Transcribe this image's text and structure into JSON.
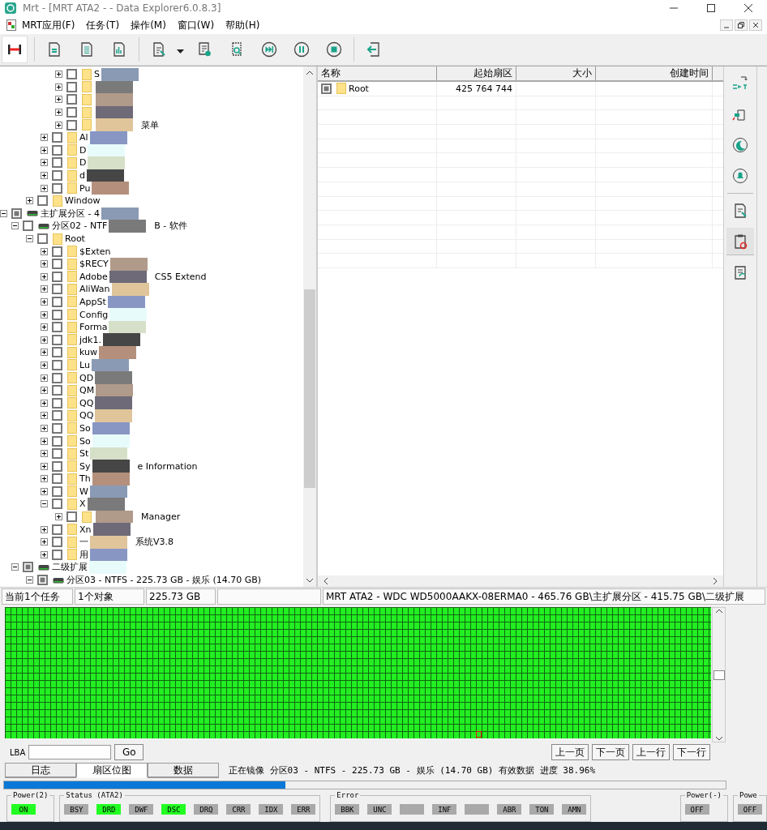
{
  "window": {
    "title": "Mrt - [MRT ATA2 -  - Data Explorer6.0.8.3]"
  },
  "menu": [
    "MRT应用(F)",
    "任务(T)",
    "操作(M)",
    "窗口(W)",
    "帮助(H)"
  ],
  "toolbar": [
    {
      "pressed": true
    },
    {
      "pressed": false
    },
    {
      "pressed": false
    },
    {
      "pressed": false
    },
    {
      "pressed": false
    },
    {
      "pressed": false
    },
    {
      "pressed": false
    },
    {
      "pressed": false
    },
    {
      "pressed": false
    },
    {
      "pressed": false
    },
    {
      "pressed": false
    }
  ],
  "tree": [
    {
      "children": [
        {
          "children": [
            {
              "children": [
                {
                  "children": [
                    {
                      "kind": "folder",
                      "label": "S",
                      "checked": false,
                      "expanded": false,
                      "masked": true
                    },
                    {
                      "kind": "folder",
                      "checked": false,
                      "expanded": false,
                      "masked": true
                    },
                    {
                      "kind": "folder",
                      "checked": false,
                      "expanded": false,
                      "masked": true
                    },
                    {
                      "kind": "folder",
                      "checked": false,
                      "expanded": false,
                      "masked": true
                    },
                    {
                      "kind": "folder",
                      "checked": false,
                      "expanded": false,
                      "masked": true,
                      "suffix": "菜单"
                    }
                  ]
                },
                {
                  "kind": "folder",
                  "label": "Al",
                  "checked": false,
                  "expanded": false,
                  "masked": true
                },
                {
                  "kind": "folder",
                  "label": "D",
                  "checked": false,
                  "expanded": false,
                  "masked": true
                },
                {
                  "kind": "folder",
                  "label": "D",
                  "checked": false,
                  "expanded": false,
                  "masked": true
                },
                {
                  "kind": "folder",
                  "label": "d",
                  "checked": false,
                  "expanded": false,
                  "masked": true
                },
                {
                  "kind": "folder",
                  "label": "Pu",
                  "checked": false,
                  "expanded": false,
                  "masked": true
                }
              ]
            },
            {
              "kind": "folder",
              "label": "Window",
              "checked": false,
              "expanded": false,
              "masked": false
            }
          ]
        }
      ]
    },
    {
      "kind": "drive",
      "label": "主扩展分区 - 4",
      "checked": true,
      "expanded": true,
      "masked": true,
      "children": [
        {
          "kind": "drive",
          "label": "分区02 - NTF",
          "checked": false,
          "expanded": true,
          "masked": true,
          "suffix": "B - 软件",
          "children": [
            {
              "kind": "folder",
              "label": "Root",
              "checked": false,
              "expanded": true,
              "masked": false,
              "children": [
                {
                  "kind": "folder",
                  "label": "$Exten",
                  "checked": false,
                  "expanded": false,
                  "masked": false
                },
                {
                  "kind": "folder",
                  "label": "$RECY",
                  "checked": false,
                  "expanded": false,
                  "masked": true
                },
                {
                  "kind": "folder",
                  "label": "Adobe",
                  "checked": false,
                  "expanded": false,
                  "masked": true,
                  "suffix": "CS5 Extend"
                },
                {
                  "kind": "folder",
                  "label": "AliWan",
                  "checked": false,
                  "expanded": false,
                  "masked": true
                },
                {
                  "kind": "folder",
                  "label": "AppSt",
                  "checked": false,
                  "expanded": false,
                  "masked": true
                },
                {
                  "kind": "folder",
                  "label": "Config",
                  "checked": false,
                  "expanded": false,
                  "masked": true
                },
                {
                  "kind": "folder",
                  "label": "Forma",
                  "checked": false,
                  "expanded": false,
                  "masked": true
                },
                {
                  "kind": "folder",
                  "label": "jdk1.",
                  "checked": false,
                  "expanded": false,
                  "masked": true
                },
                {
                  "kind": "folder",
                  "label": "kuw",
                  "checked": false,
                  "expanded": false,
                  "masked": true
                },
                {
                  "kind": "folder",
                  "label": "Lu",
                  "checked": false,
                  "expanded": false,
                  "masked": true
                },
                {
                  "kind": "folder",
                  "label": "QD",
                  "checked": false,
                  "expanded": false,
                  "masked": true
                },
                {
                  "kind": "folder",
                  "label": "QM",
                  "checked": false,
                  "expanded": false,
                  "masked": true
                },
                {
                  "kind": "folder",
                  "label": "QQ",
                  "checked": false,
                  "expanded": false,
                  "masked": true
                },
                {
                  "kind": "folder",
                  "label": "QQ",
                  "checked": false,
                  "expanded": false,
                  "masked": true
                },
                {
                  "kind": "folder",
                  "label": "So",
                  "checked": false,
                  "expanded": false,
                  "masked": true
                },
                {
                  "kind": "folder",
                  "label": "So",
                  "checked": false,
                  "expanded": false,
                  "masked": true
                },
                {
                  "kind": "folder",
                  "label": "St",
                  "checked": false,
                  "expanded": false,
                  "masked": true
                },
                {
                  "kind": "folder",
                  "label": "Sy",
                  "checked": false,
                  "expanded": false,
                  "masked": true,
                  "suffix": "e Information"
                },
                {
                  "kind": "folder",
                  "label": "Th",
                  "checked": false,
                  "expanded": false,
                  "masked": true
                },
                {
                  "kind": "folder",
                  "label": "W",
                  "checked": false,
                  "expanded": false,
                  "masked": true
                },
                {
                  "kind": "folder",
                  "label": "X",
                  "checked": false,
                  "expanded": true,
                  "masked": true,
                  "children": [
                    {
                      "kind": "folder",
                      "checked": false,
                      "expanded": false,
                      "masked": true,
                      "suffix": "Manager"
                    }
                  ]
                },
                {
                  "kind": "folder",
                  "label": "Xn",
                  "checked": false,
                  "expanded": false,
                  "masked": true
                },
                {
                  "kind": "folder",
                  "label": "一",
                  "checked": false,
                  "expanded": false,
                  "masked": true,
                  "suffix": "系统V3.8"
                },
                {
                  "kind": "folder",
                  "label": "用",
                  "checked": false,
                  "expanded": false,
                  "masked": true
                }
              ]
            }
          ]
        },
        {
          "kind": "drive",
          "label": "二级扩展",
          "checked": true,
          "expanded": true,
          "masked": true,
          "children": [
            {
              "kind": "drive",
              "label": "分区03 - NTFS - 225.73 GB - 娱乐 (14.70 GB)",
              "checked": true,
              "expanded": true,
              "masked": false
            }
          ]
        }
      ]
    }
  ],
  "list": {
    "columns": [
      "名称",
      "起始扇区",
      "大小",
      "创建时间"
    ],
    "rows": [
      {
        "checked": true,
        "name": "Root",
        "start_sector": "425 764 744"
      }
    ]
  },
  "side_tools": [
    {
      "selected": false
    },
    {
      "selected": false
    },
    {
      "selected": false
    },
    {
      "selected": false
    },
    {
      "selected": false
    },
    {
      "selected": true
    },
    {
      "selected": false
    }
  ],
  "status_strip": [
    "当前1个任务",
    "1个对象",
    "225.73 GB",
    "MRT ATA2 - WDC WD5000AAKX-08ERMA0 - 465.76 GB\\主扩展分区 - 415.75 GB\\二级扩展"
  ],
  "lba": {
    "label": "LBA",
    "button": "Go"
  },
  "nav_buttons": [
    "上一页",
    "下一页",
    "上一行",
    "下一行"
  ],
  "tabs": [
    {
      "label": "日志",
      "selected": false
    },
    {
      "label": "扇区位图",
      "selected": true
    },
    {
      "label": "数据",
      "selected": false
    }
  ],
  "task_text": "正在镜像 分区03 - NTFS - 225.73 GB - 娱乐 (14.70 GB) 有效数据  进度 38.96%",
  "progress": {
    "level": 0.39
  },
  "indicator_groups": [
    {
      "title": "Power(2)",
      "items": [
        {
          "label": "ON",
          "on": true
        }
      ]
    },
    {
      "title": "Status (ATA2)",
      "items": [
        {
          "label": "BSY",
          "on": false
        },
        {
          "label": "DRD",
          "on": true
        },
        {
          "label": "DWF",
          "on": false
        },
        {
          "label": "DSC",
          "on": true
        },
        {
          "label": "DRQ",
          "on": false
        },
        {
          "label": "CRR",
          "on": false
        },
        {
          "label": "IDX",
          "on": false
        },
        {
          "label": "ERR",
          "on": false
        }
      ]
    },
    {
      "title": "Error",
      "items": [
        {
          "label": "BBK",
          "on": false
        },
        {
          "label": "UNC",
          "on": false
        },
        {
          "on": false
        },
        {
          "label": "INF",
          "on": false
        },
        {
          "on": false
        },
        {
          "label": "ABR",
          "on": false
        },
        {
          "label": "TON",
          "on": false
        },
        {
          "label": "AMN",
          "on": false
        }
      ]
    },
    {
      "title": "Power(-)",
      "items": [
        {
          "label": "OFF",
          "on": false
        }
      ]
    },
    {
      "title": "Powe",
      "items": [
        {
          "label": "OFF",
          "on": false
        }
      ]
    }
  ]
}
